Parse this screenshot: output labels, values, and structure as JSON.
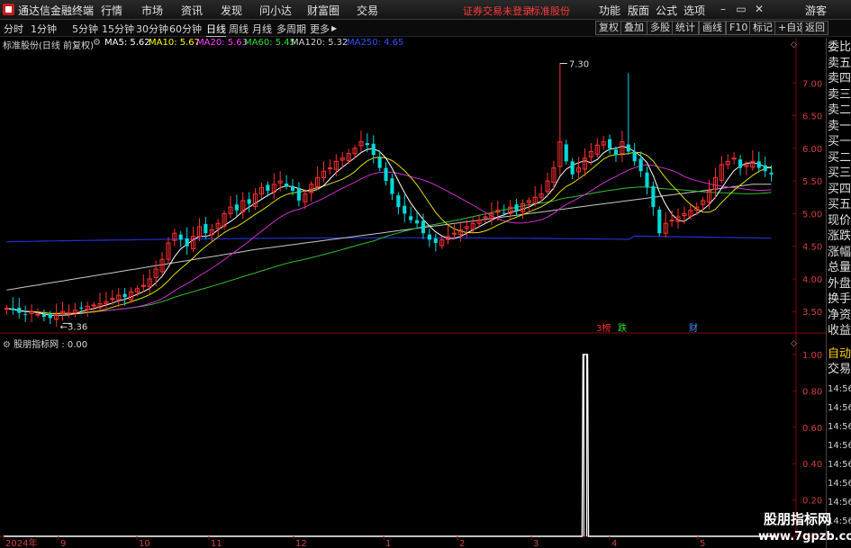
{
  "window": {
    "title": "通达信金融终端",
    "menu": [
      "行情",
      "市场",
      "资讯",
      "发现",
      "问小达",
      "财富圈",
      "交易"
    ],
    "notice": "证券交易未登录",
    "stock_name_red": "标准股份",
    "right_menu": [
      "功能",
      "版面",
      "公式",
      "选项"
    ],
    "user": "游客"
  },
  "toolbar": {
    "periods": [
      "分时",
      "1分钟",
      "5分钟",
      "15分钟",
      "30分钟",
      "60分钟",
      "日线",
      "周线",
      "月线",
      "多周期",
      "更多"
    ],
    "active_period": "日线",
    "buttons": [
      "复权",
      "叠加",
      "多股",
      "统计",
      "画线",
      "F10",
      "标记",
      "+自选",
      "返回"
    ]
  },
  "info": {
    "stock": "标准股份(日线 前复权)",
    "ma": [
      {
        "label": "MA5: 5.62",
        "color": "#ffffff"
      },
      {
        "label": "MA10: 5.67",
        "color": "#ffff00"
      },
      {
        "label": "MA20: 5.63",
        "color": "#ff40ff"
      },
      {
        "label": "MA60: 5.45",
        "color": "#30e030"
      },
      {
        "label": "MA120: 5.32",
        "color": "#d0d0d0"
      },
      {
        "label": "MA250: 4.65",
        "color": "#3050ff"
      }
    ]
  },
  "price_axis": [
    "7.00",
    "6.50",
    "6.00",
    "5.50",
    "5.00",
    "4.50",
    "4.00",
    "3.50"
  ],
  "price_labels": {
    "high": "7.30",
    "low": "3.36"
  },
  "event_tags": [
    {
      "text": "3榜",
      "color": "#ff3030"
    },
    {
      "text": "跌",
      "color": "#30e030"
    },
    {
      "text": "财",
      "color": "#4090ff"
    }
  ],
  "indicator": {
    "title": "股朋指标网 : 0.00",
    "axis": [
      "1.00",
      "0.80",
      "0.60",
      "0.40",
      "0.20"
    ]
  },
  "time_axis": [
    "2024年",
    "9",
    "10",
    "11",
    "12",
    "1",
    "2",
    "3",
    "4",
    "5"
  ],
  "right_panel": {
    "quote_items": [
      "委比",
      "卖五",
      "卖四",
      "卖三",
      "卖二",
      "卖一",
      "买一",
      "买二",
      "买三",
      "买四",
      "买五",
      "现价",
      "涨跌",
      "涨幅",
      "总量",
      "外盘",
      "换手",
      "净资",
      "收益"
    ],
    "trade_items": [
      "自动",
      "交易"
    ],
    "times": [
      "14:56",
      "14:56",
      "14:56",
      "14:56",
      "14:56",
      "14:56",
      "14:56",
      "14:56"
    ]
  },
  "watermark": {
    "name": "股朋指标网",
    "url": "www.7gpzb.com"
  },
  "chart_data": {
    "type": "candlestick",
    "ylim": [
      3.2,
      7.5
    ],
    "close": [
      3.55,
      3.52,
      3.48,
      3.45,
      3.5,
      3.46,
      3.42,
      3.4,
      3.45,
      3.5,
      3.48,
      3.52,
      3.55,
      3.58,
      3.6,
      3.62,
      3.65,
      3.7,
      3.75,
      3.72,
      3.8,
      3.85,
      3.9,
      4.0,
      4.15,
      4.3,
      4.55,
      4.7,
      4.6,
      4.5,
      4.65,
      4.8,
      4.7,
      4.75,
      4.85,
      5.0,
      5.1,
      5.05,
      5.2,
      5.15,
      5.3,
      5.4,
      5.35,
      5.45,
      5.5,
      5.42,
      5.35,
      5.2,
      5.3,
      5.45,
      5.55,
      5.65,
      5.7,
      5.8,
      5.85,
      5.92,
      6.0,
      6.1,
      6.05,
      5.9,
      5.7,
      5.5,
      5.3,
      5.1,
      5.0,
      4.9,
      4.85,
      4.7,
      4.6,
      4.55,
      4.6,
      4.65,
      4.7,
      4.75,
      4.8,
      4.85,
      4.9,
      4.95,
      5.0,
      5.05,
      5.0,
      5.1,
      5.05,
      5.15,
      5.2,
      5.25,
      5.3,
      5.5,
      5.7,
      6.1,
      5.8,
      5.6,
      5.7,
      5.85,
      5.95,
      6.05,
      6.1,
      6.0,
      5.9,
      6.1,
      5.95,
      5.8,
      5.65,
      5.4,
      5.1,
      4.7,
      4.85,
      4.9,
      4.95,
      5.0,
      5.05,
      5.1,
      5.2,
      5.35,
      5.55,
      5.75,
      5.8,
      5.85,
      5.7,
      5.75,
      5.8,
      5.7,
      5.65,
      5.6
    ],
    "indicator_values": "0.00 except a single bar at the last trading days of February equal to 1.00"
  }
}
